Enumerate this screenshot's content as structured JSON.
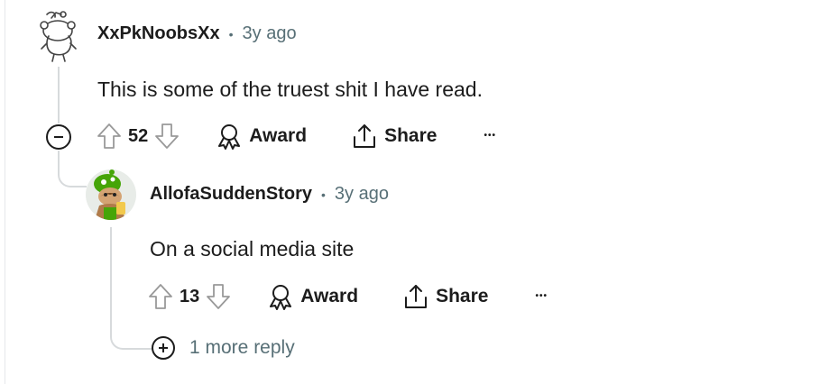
{
  "comments": [
    {
      "username": "XxPkNoobsXx",
      "separator": "•",
      "time": "3y ago",
      "body": "This is some of the truest shit I have read.",
      "score": "52",
      "award_label": "Award",
      "share_label": "Share",
      "more_label": "•••"
    },
    {
      "username": "AllofaSuddenStory",
      "separator": "•",
      "time": "3y ago",
      "body": "On a social media site",
      "score": "13",
      "award_label": "Award",
      "share_label": "Share",
      "more_label": "•••"
    }
  ],
  "more_replies": {
    "label": "1 more reply"
  },
  "colors": {
    "text": "#1c1c1c",
    "meta": "#576f76",
    "thread_line": "#d7dadc",
    "avatar_green": "#46a508"
  },
  "icons": [
    "snoo-avatar-icon",
    "upvote-icon",
    "downvote-icon",
    "award-icon",
    "share-icon",
    "collapse-icon",
    "expand-icon",
    "more-options-icon"
  ]
}
